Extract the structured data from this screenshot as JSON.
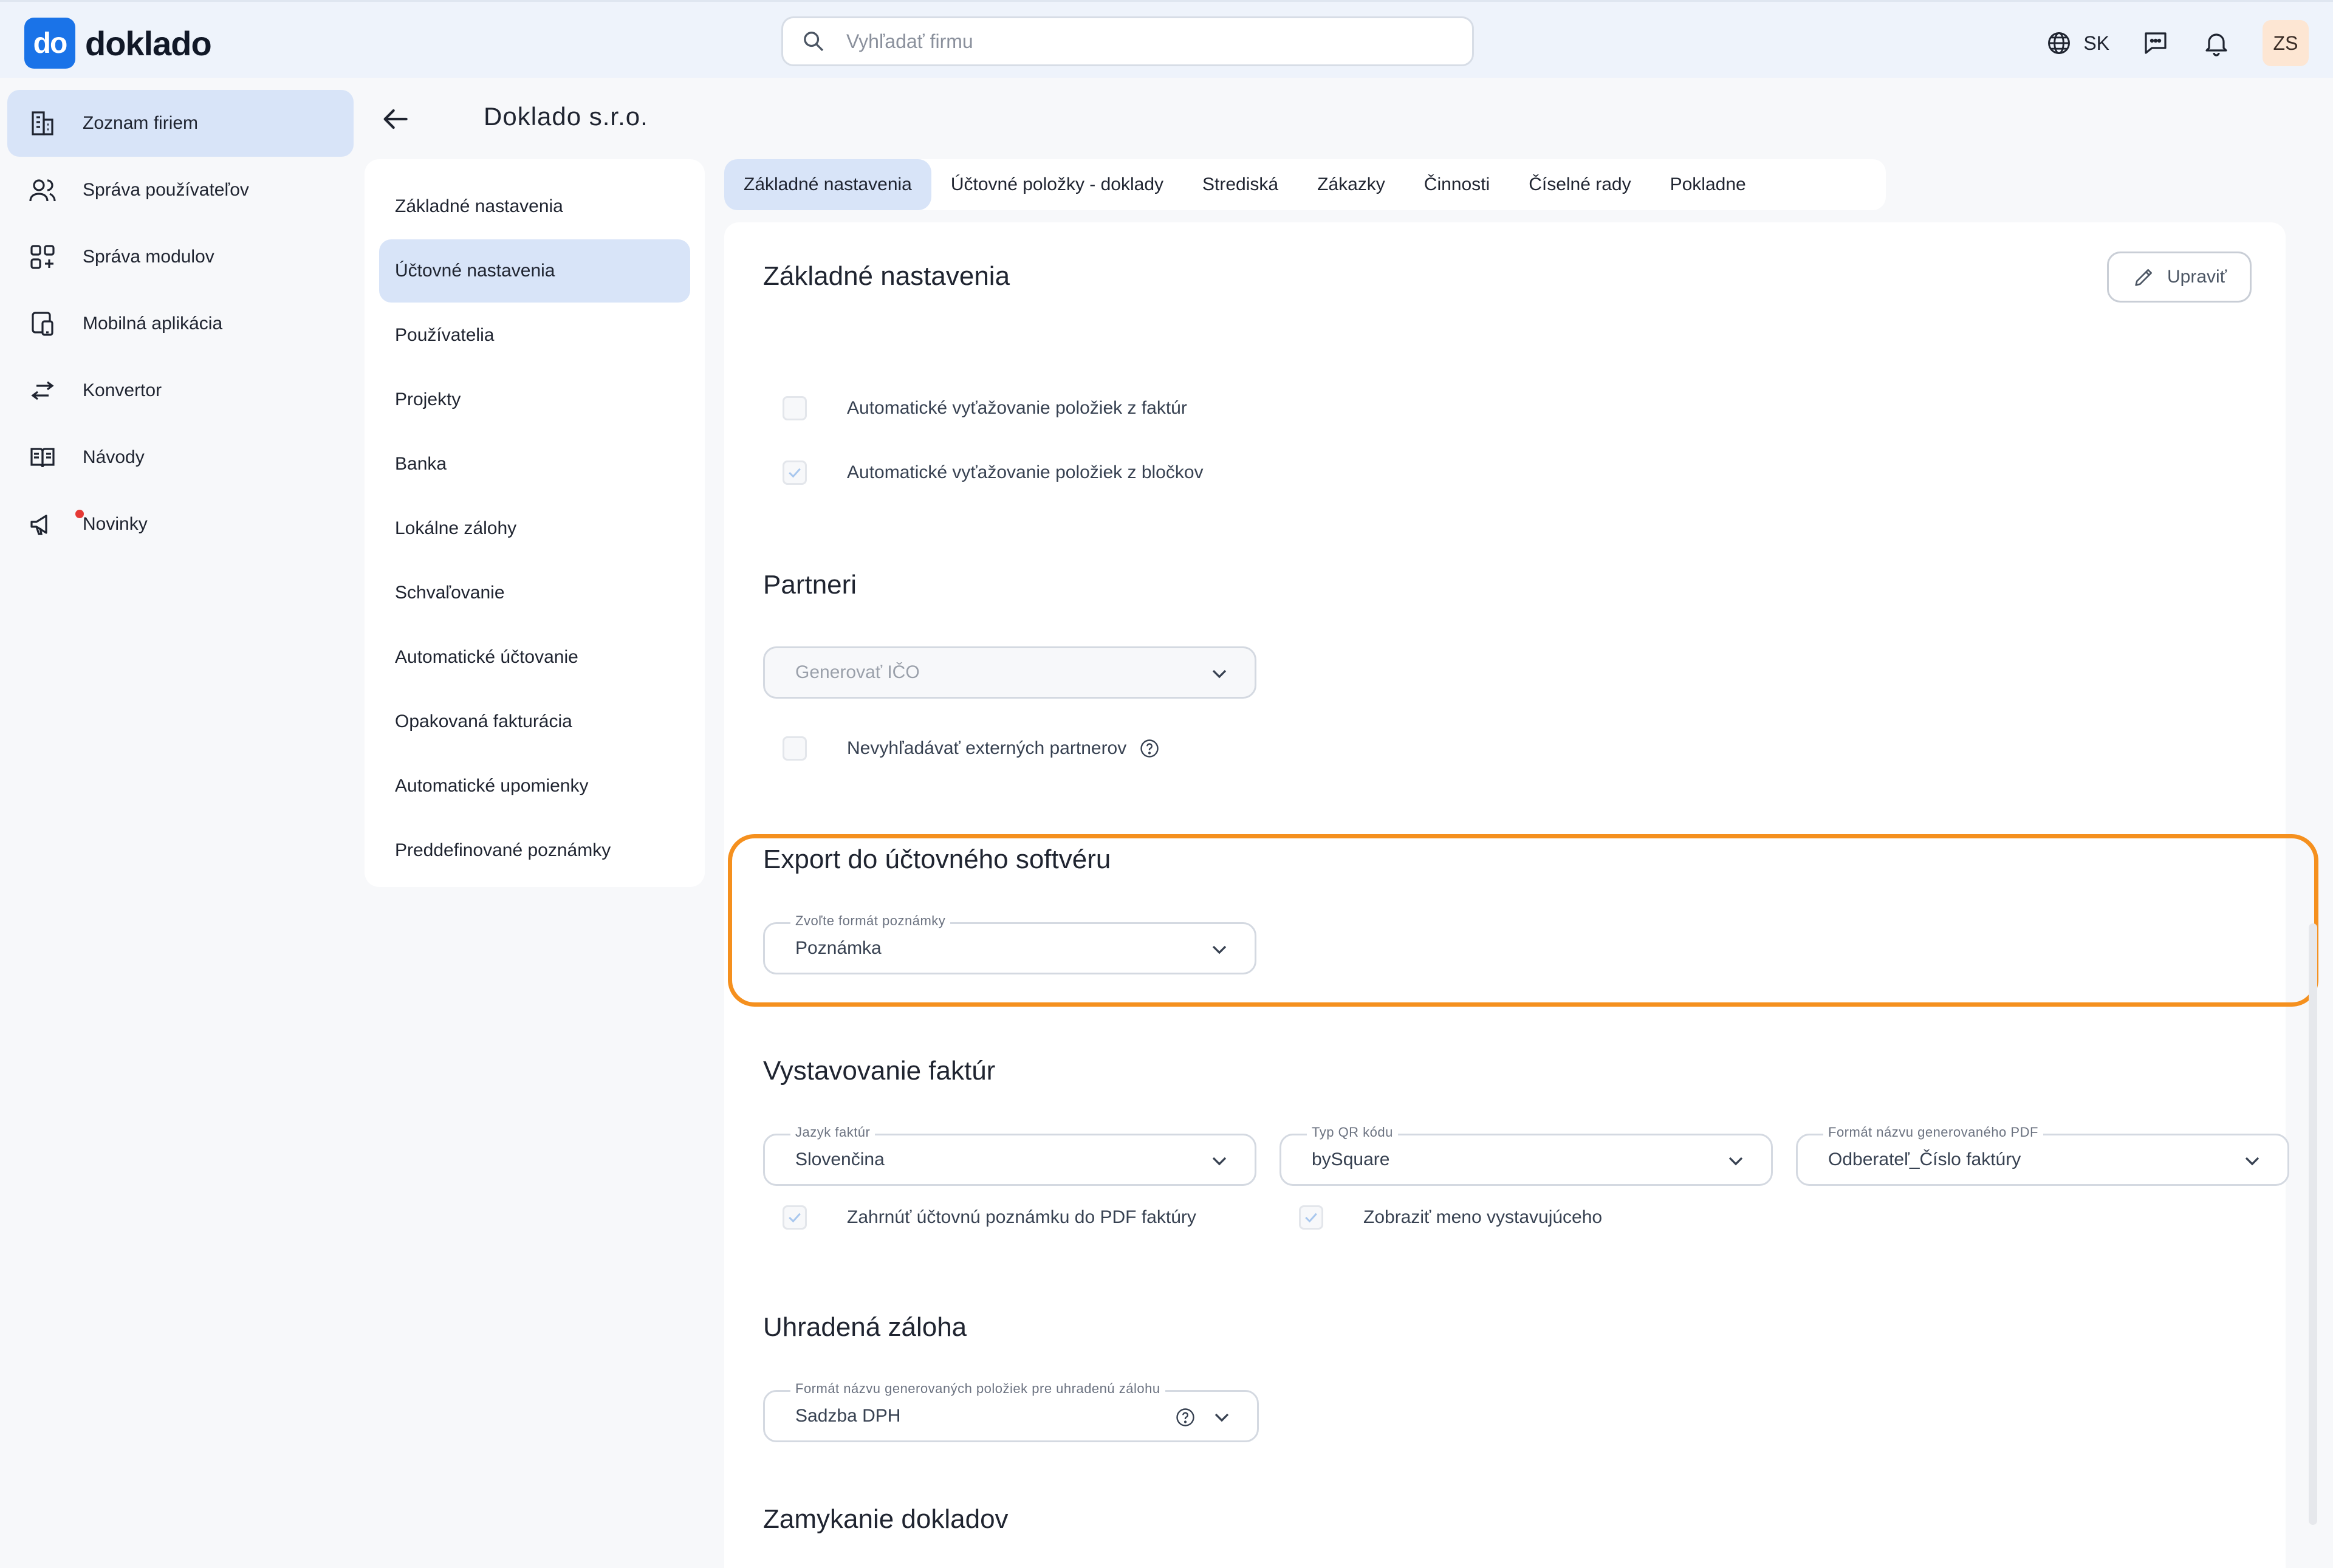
{
  "header": {
    "logo_mark": "do",
    "logo_text": "doklado",
    "search_placeholder": "Vyhľadať firmu",
    "language": "SK",
    "user_initials": "ZS"
  },
  "sidebar": {
    "items": [
      {
        "label": "Zoznam firiem",
        "icon": "building-icon",
        "active": true
      },
      {
        "label": "Správa používateľov",
        "icon": "users-icon",
        "active": false
      },
      {
        "label": "Správa modulov",
        "icon": "modules-icon",
        "active": false
      },
      {
        "label": "Mobilná aplikácia",
        "icon": "mobile-icon",
        "active": false
      },
      {
        "label": "Konvertor",
        "icon": "convert-icon",
        "active": false
      },
      {
        "label": "Návody",
        "icon": "book-icon",
        "active": false
      },
      {
        "label": "Novinky",
        "icon": "megaphone-icon",
        "active": false
      }
    ]
  },
  "company": {
    "title": "Doklado s.r.o."
  },
  "subnav": {
    "items": [
      "Základné nastavenia",
      "Účtovné nastavenia",
      "Používatelia",
      "Projekty",
      "Banka",
      "Lokálne zálohy",
      "Schvaľovanie",
      "Automatické účtovanie",
      "Opakovaná fakturácia",
      "Automatické upomienky",
      "Preddefinované poznámky"
    ],
    "active_index": 1
  },
  "tabs": {
    "items": [
      "Základné nastavenia",
      "Účtovné položky - doklady",
      "Strediská",
      "Zákazky",
      "Činnosti",
      "Číselné rady",
      "Pokladne"
    ],
    "active_index": 0
  },
  "main": {
    "edit_label": "Upraviť",
    "basic": {
      "title": "Základné nastavenia",
      "checks": [
        {
          "label": "Automatické vyťažovanie položiek z faktúr",
          "checked": false
        },
        {
          "label": "Automatické vyťažovanie položiek z bločkov",
          "checked": true
        }
      ]
    },
    "partners": {
      "title": "Partneri",
      "select_value": "Generovať IČO",
      "check_label": "Nevyhľadávať externých partnerov"
    },
    "export": {
      "title": "Export do účtovného softvéru",
      "select_label": "Zvoľte formát poznámky",
      "select_value": "Poznámka"
    },
    "invoicing": {
      "title": "Vystavovanie faktúr",
      "language_label": "Jazyk faktúr",
      "language_value": "Slovenčina",
      "qr_label": "Typ QR kódu",
      "qr_value": "bySquare",
      "pdf_label": "Formát názvu generovaného PDF",
      "pdf_value": "Odberateľ_Číslo faktúry",
      "check1": "Zahrnúť účtovnú poznámku do PDF faktúry",
      "check2": "Zobraziť meno vystavujúceho"
    },
    "deposit": {
      "title": "Uhradená záloha",
      "select_label": "Formát názvu generovaných položiek pre uhradenú zálohu",
      "select_value": "Sadzba DPH"
    },
    "locking": {
      "title": "Zamykanie dokladov"
    }
  },
  "colors": {
    "accent": "#1a73e8",
    "active_bg": "#d8e4f8",
    "highlight": "#f5901e"
  }
}
